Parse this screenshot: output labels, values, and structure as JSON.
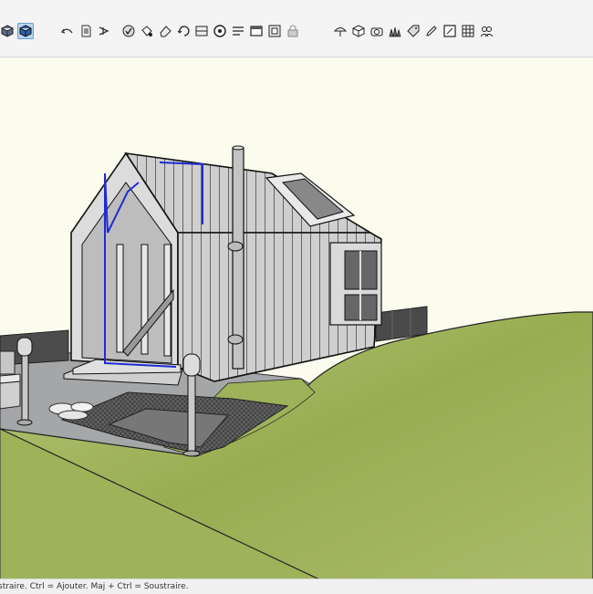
{
  "toolbar": {
    "groups": [
      {
        "name": "view",
        "buttons": [
          {
            "id": "iso-cube-icon",
            "active": false
          },
          {
            "id": "xray-icon",
            "active": true
          }
        ]
      },
      {
        "name": "edit",
        "buttons": [
          {
            "id": "undo-arrow-icon",
            "active": false
          },
          {
            "id": "document-icon",
            "active": false
          },
          {
            "id": "redo-arrow-icon",
            "active": false
          }
        ]
      },
      {
        "name": "tools",
        "buttons": [
          {
            "id": "select-tool-icon",
            "active": false
          },
          {
            "id": "paint-bucket-icon",
            "active": false
          },
          {
            "id": "eraser-icon",
            "active": false
          },
          {
            "id": "rotate-icon",
            "active": false
          },
          {
            "id": "section-plane-icon",
            "active": false
          },
          {
            "id": "orbit-icon",
            "active": false
          },
          {
            "id": "dimension-icon",
            "active": false
          },
          {
            "id": "window-icon",
            "active": false
          },
          {
            "id": "component-icon",
            "active": false
          },
          {
            "id": "lock-icon",
            "active": false
          }
        ]
      },
      {
        "name": "styles",
        "buttons": [
          {
            "id": "umbrella-icon",
            "active": false
          },
          {
            "id": "box-icon",
            "active": false
          },
          {
            "id": "camera-icon",
            "active": false
          },
          {
            "id": "grass-icon",
            "active": false
          },
          {
            "id": "tag-icon",
            "active": false
          },
          {
            "id": "pencil-icon",
            "active": false
          },
          {
            "id": "frame-icon",
            "active": false
          },
          {
            "id": "grid-icon",
            "active": false
          },
          {
            "id": "users-icon",
            "active": false
          }
        ]
      }
    ]
  },
  "colors": {
    "sky": "#fbfbee",
    "terrain": "#9eb25a",
    "house_wall": "#cfcfcf",
    "selection": "#1f2bd6"
  },
  "status": {
    "text": "straire. Ctrl = Ajouter. Maj + Ctrl = Soustraire."
  }
}
